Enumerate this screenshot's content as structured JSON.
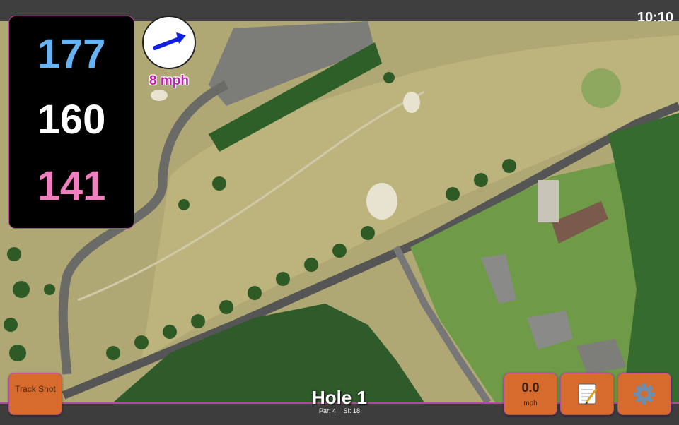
{
  "status": {
    "time": "10:10"
  },
  "distances": {
    "back": "177",
    "middle": "160",
    "front": "141"
  },
  "wind": {
    "speed_label": "8 mph",
    "direction_deg": 20
  },
  "buttons": {
    "track_shot": "Track Shot",
    "wind_value": "0.0",
    "wind_unit": "mph",
    "notes_icon": "notepad-icon",
    "settings_icon": "gear-icon"
  },
  "hole": {
    "title": "Hole 1",
    "par": "Par: 4",
    "si": "SI: 18"
  },
  "colors": {
    "back": "#66b2f2",
    "middle": "#ffffff",
    "front": "#f07fc0",
    "button": "#d76b2e",
    "accent": "#b04aa0",
    "wind_arrow": "#1020e0"
  }
}
